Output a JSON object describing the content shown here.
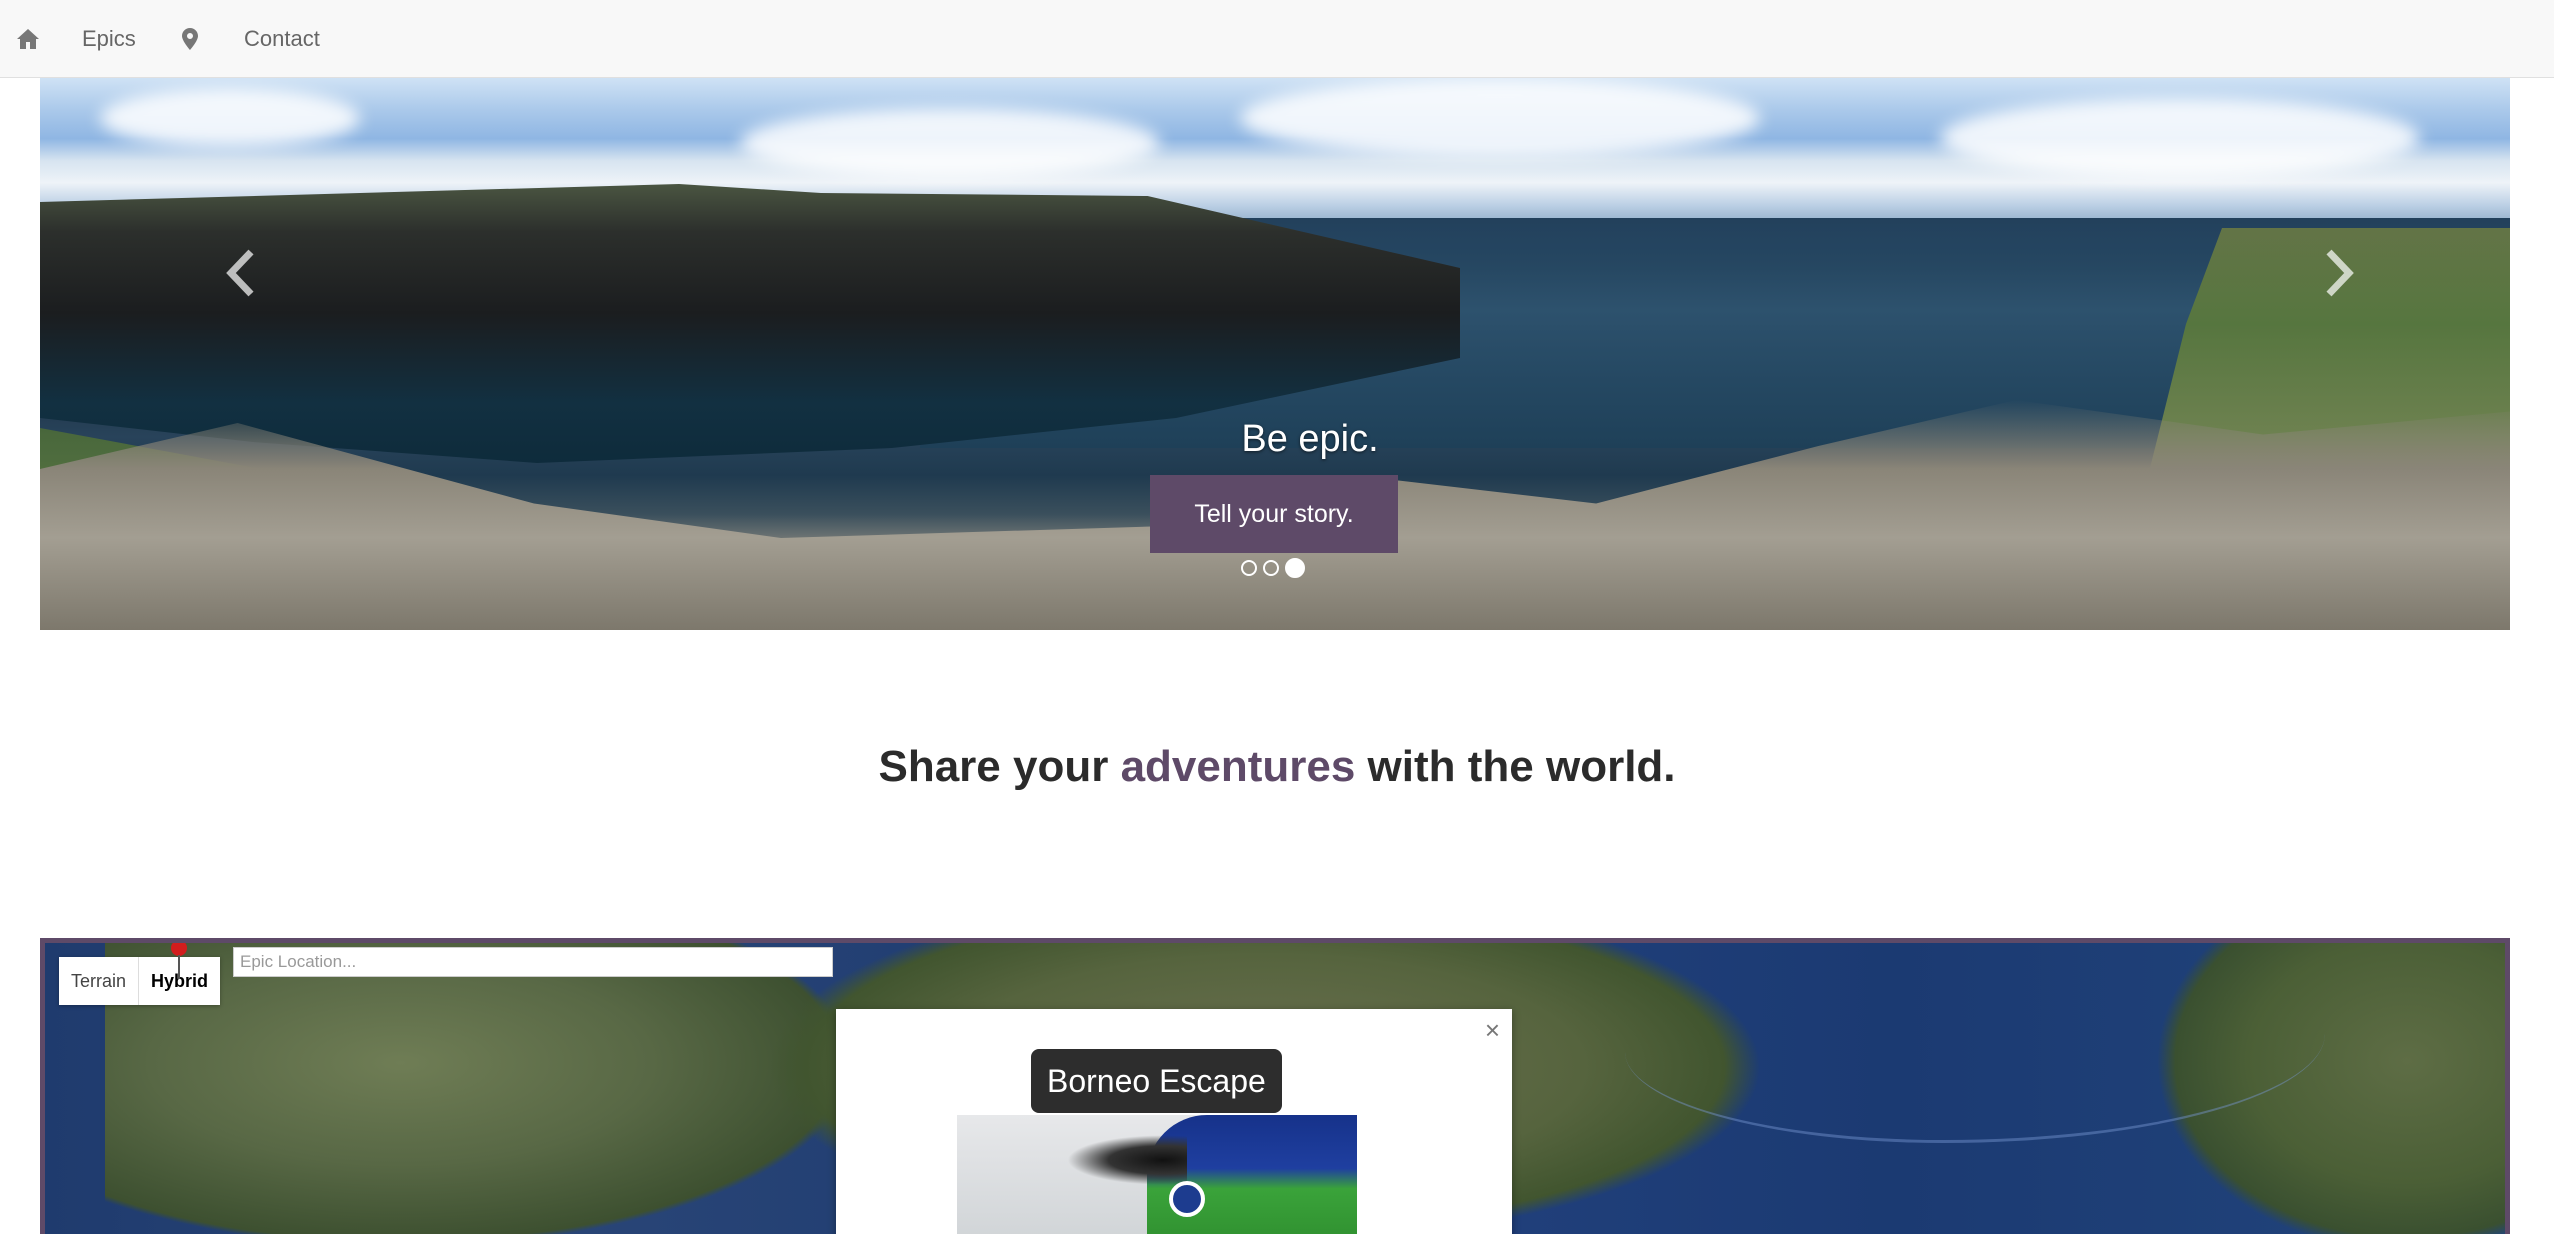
{
  "nav": {
    "home_icon": "home-icon",
    "epics_label": "Epics",
    "location_icon": "map-pin-icon",
    "contact_label": "Contact"
  },
  "carousel": {
    "caption_title": "Be epic.",
    "cta_label": "Tell your story.",
    "prev_icon": "chevron-left-icon",
    "next_icon": "chevron-right-icon",
    "indicator_count": 3,
    "active_index": 2
  },
  "tagline": {
    "before": "Share your ",
    "accent": "adventures",
    "after": " with the world."
  },
  "map": {
    "type_options": [
      "Terrain",
      "Hybrid"
    ],
    "selected_type": "Hybrid",
    "search_placeholder": "Epic Location...",
    "marker_icon": "map-marker-icon",
    "infowindow": {
      "title": "Borneo Escape",
      "close_label": "×"
    }
  },
  "colors": {
    "accent": "#5e4a68",
    "navbar_bg": "#f8f8f8",
    "text_dark": "#2b2b2b"
  }
}
